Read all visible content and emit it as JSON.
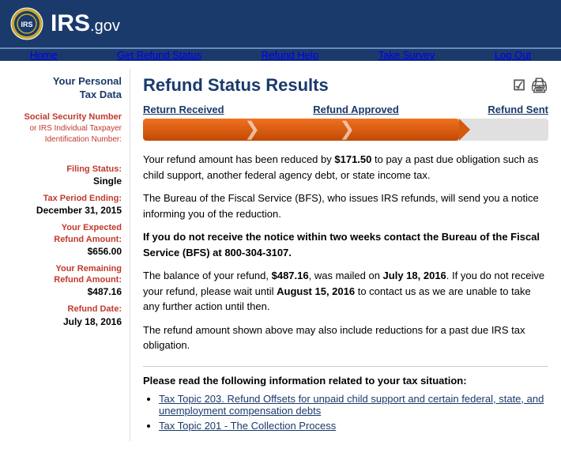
{
  "header": {
    "logo_text": "IRS",
    "gov_text": ".gov"
  },
  "navbar": {
    "items": [
      {
        "label": "Home",
        "id": "home"
      },
      {
        "label": "Get Refund Status",
        "id": "get-refund-status"
      },
      {
        "label": "Refund Help",
        "id": "refund-help"
      },
      {
        "label": "Take Survey",
        "id": "take-survey"
      },
      {
        "label": "Log Out",
        "id": "log-out"
      }
    ]
  },
  "sidebar": {
    "title": "Your Personal\nTax Data",
    "fields": [
      {
        "label": "Social Security Number\nor IRS Individual Taxpayer\nIdentification Number:",
        "value": ""
      },
      {
        "label": "Filing Status:",
        "value": "Single"
      },
      {
        "label": "Tax Period Ending:",
        "value": "December 31, 2015"
      },
      {
        "label": "Your Expected\nRefund Amount:",
        "value": "$656.00"
      },
      {
        "label": "Your Remaining\nRefund Amount:",
        "value": "$487.16"
      },
      {
        "label": "Refund Date:",
        "value": "July 18, 2016"
      }
    ]
  },
  "content": {
    "page_title": "Refund Status Results",
    "progress_steps": [
      {
        "label": "Return Received"
      },
      {
        "label": "Refund Approved"
      },
      {
        "label": "Refund Sent"
      }
    ],
    "paragraphs": [
      "Your refund amount has been reduced by <strong>$171.50</strong> to pay a past due obligation such as child support, another federal agency debt, or state income tax.",
      "The Bureau of the Fiscal Service (BFS), who issues IRS refunds, will send you a notice informing you of the reduction.",
      "<strong>If you do not receive the notice within two weeks contact the Bureau of the Fiscal Service (BFS) at 800-304-3107.</strong>",
      "The balance of your refund, <strong>$487.16</strong>, was mailed on <strong>July 18, 2016</strong>. If you do not receive your refund, please wait until <strong>August 15, 2016</strong> to contact us as we are unable to take any further action until then.",
      "The refund amount shown above may also include reductions for a past due IRS tax obligation."
    ],
    "please_read": {
      "title": "Please read the following information related to your tax situation:",
      "links": [
        {
          "text": "Tax Topic 203. Refund Offsets for unpaid child support and certain federal, state, and unemployment compensation debts",
          "href": "#"
        },
        {
          "text": "Tax Topic 201 - The Collection Process",
          "href": "#"
        }
      ]
    }
  }
}
